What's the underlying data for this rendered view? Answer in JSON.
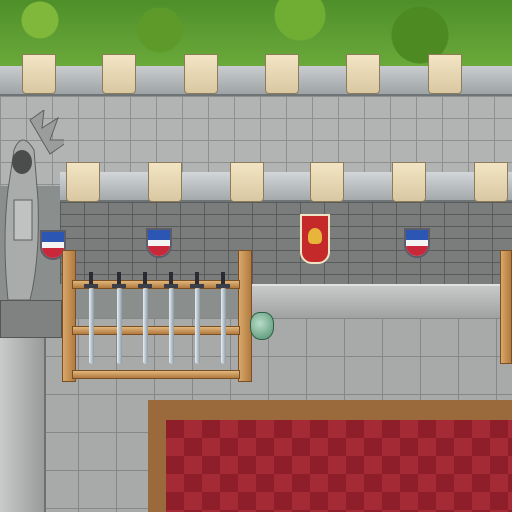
{
  "scene": {
    "name": "castle-armory-map",
    "colors": {
      "grass": "#5e9a2a",
      "stone": "#b2b4b3",
      "wall": "#7a7d7c",
      "merlon": "#efe0bd",
      "wood": "#c8904f",
      "carpet": "#8d1e2a",
      "banner_red": "#c42a2a",
      "shield_blue": "#2c56b4"
    }
  },
  "objects": {
    "statue": {
      "icon": "hooded-statue-icon"
    },
    "weapon_rack": {
      "icon": "weapon-rack-icon",
      "sword_count": 6
    },
    "vase": {
      "icon": "green-vase-icon"
    },
    "carpet": {
      "icon": "red-carpet-icon"
    },
    "banners": [
      {
        "icon": "shield-banner-icon"
      },
      {
        "icon": "shield-banner-icon"
      },
      {
        "icon": "red-eagle-banner-icon"
      },
      {
        "icon": "shield-banner-icon"
      }
    ]
  }
}
